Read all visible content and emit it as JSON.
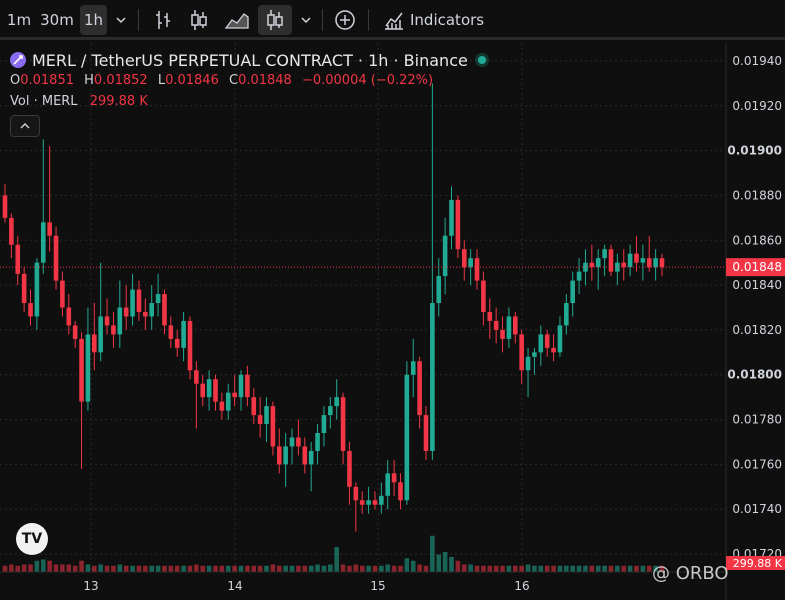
{
  "toolbar": {
    "intervals": [
      "1m",
      "30m",
      "1h"
    ],
    "active_interval": "1h",
    "indicators_label": "Indicators",
    "icons": [
      "chevron-down-icon",
      "bar-style-icon",
      "candle-style-icon",
      "area-style-icon",
      "hollow-candle-style-icon",
      "chevron-down-icon",
      "add-compare-icon",
      "indicators-icon"
    ]
  },
  "legend": {
    "title": "MERL / TetherUS PERPETUAL CONTRACT · 1h · Binance",
    "o_label": "O",
    "o_value": "0.01851",
    "h_label": "H",
    "h_value": "0.01852",
    "l_label": "L",
    "l_value": "0.01846",
    "c_label": "C",
    "c_value": "0.01848",
    "change": "−0.00004 (−0.22%)",
    "vol_label": "Vol · MERL",
    "vol_value": "299.88 K",
    "collapse_icon": "chevron-up-icon"
  },
  "branding": {
    "tv_logo": "TV",
    "watermark": "@ ORBO"
  },
  "colors": {
    "up": "#22ab94",
    "down": "#f23645",
    "grid": "#2a2a2a",
    "background": "#0f0f0f"
  },
  "chart_data": {
    "type": "candlestick",
    "symbol": "MERL / TetherUS PERPETUAL CONTRACT",
    "timeframe": "1h",
    "exchange": "Binance",
    "x_ticks": [
      "13",
      "14",
      "15",
      "16"
    ],
    "y_ticks": [
      "0.01720",
      "0.01740",
      "0.01760",
      "0.01780",
      "0.01800",
      "0.01820",
      "0.01840",
      "0.01860",
      "0.01880",
      "0.01900",
      "0.01920",
      "0.01940"
    ],
    "ylim": [
      0.01712,
      0.01948
    ],
    "grid": true,
    "last_price": "0.01848",
    "last_volume": "299.88 K",
    "candles": [
      [
        0.0188,
        0.01885,
        0.01868,
        0.0187
      ],
      [
        0.0187,
        0.01872,
        0.01852,
        0.01858
      ],
      [
        0.01858,
        0.01862,
        0.0184,
        0.01845
      ],
      [
        0.01845,
        0.01848,
        0.01828,
        0.01832
      ],
      [
        0.01832,
        0.01838,
        0.01822,
        0.01826
      ],
      [
        0.01826,
        0.01852,
        0.0182,
        0.0185
      ],
      [
        0.0185,
        0.01905,
        0.01845,
        0.01868
      ],
      [
        0.01868,
        0.01902,
        0.01855,
        0.01862
      ],
      [
        0.01862,
        0.01866,
        0.01838,
        0.01842
      ],
      [
        0.01842,
        0.01846,
        0.01826,
        0.0183
      ],
      [
        0.0183,
        0.01836,
        0.01818,
        0.01822
      ],
      [
        0.01822,
        0.01824,
        0.01812,
        0.01816
      ],
      [
        0.01816,
        0.01819,
        0.01758,
        0.01788
      ],
      [
        0.01788,
        0.0183,
        0.01784,
        0.01818
      ],
      [
        0.01818,
        0.01832,
        0.01802,
        0.0181
      ],
      [
        0.0181,
        0.0185,
        0.01806,
        0.01826
      ],
      [
        0.01826,
        0.01834,
        0.01818,
        0.01822
      ],
      [
        0.01822,
        0.01828,
        0.01812,
        0.01818
      ],
      [
        0.01818,
        0.01842,
        0.01812,
        0.0183
      ],
      [
        0.0183,
        0.0184,
        0.0182,
        0.01826
      ],
      [
        0.01826,
        0.01845,
        0.01822,
        0.01838
      ],
      [
        0.01838,
        0.01842,
        0.01824,
        0.01828
      ],
      [
        0.01828,
        0.01834,
        0.0182,
        0.01826
      ],
      [
        0.01826,
        0.0184,
        0.0182,
        0.01832
      ],
      [
        0.01832,
        0.01845,
        0.01826,
        0.01836
      ],
      [
        0.01836,
        0.01838,
        0.01818,
        0.01822
      ],
      [
        0.01822,
        0.01826,
        0.01812,
        0.01816
      ],
      [
        0.01816,
        0.0182,
        0.01808,
        0.01812
      ],
      [
        0.01812,
        0.01828,
        0.01806,
        0.01824
      ],
      [
        0.01824,
        0.01826,
        0.01798,
        0.01802
      ],
      [
        0.01802,
        0.01806,
        0.01776,
        0.01796
      ],
      [
        0.01796,
        0.018,
        0.01786,
        0.0179
      ],
      [
        0.0179,
        0.01802,
        0.01784,
        0.01798
      ],
      [
        0.01798,
        0.018,
        0.01784,
        0.01788
      ],
      [
        0.01788,
        0.01792,
        0.0178,
        0.01784
      ],
      [
        0.01784,
        0.01796,
        0.0178,
        0.01792
      ],
      [
        0.01792,
        0.018,
        0.01786,
        0.0179
      ],
      [
        0.0179,
        0.01802,
        0.01784,
        0.018
      ],
      [
        0.018,
        0.01804,
        0.01786,
        0.0179
      ],
      [
        0.0179,
        0.01794,
        0.01778,
        0.01782
      ],
      [
        0.01782,
        0.0179,
        0.01772,
        0.01778
      ],
      [
        0.01778,
        0.0179,
        0.0177,
        0.01786
      ],
      [
        0.01786,
        0.01788,
        0.01764,
        0.01768
      ],
      [
        0.01768,
        0.01776,
        0.01756,
        0.0176
      ],
      [
        0.0176,
        0.01774,
        0.0175,
        0.01768
      ],
      [
        0.01768,
        0.01776,
        0.0176,
        0.01772
      ],
      [
        0.01772,
        0.0178,
        0.01764,
        0.01768
      ],
      [
        0.01768,
        0.01772,
        0.01756,
        0.0176
      ],
      [
        0.0176,
        0.0177,
        0.01748,
        0.01766
      ],
      [
        0.01766,
        0.01778,
        0.0176,
        0.01774
      ],
      [
        0.01774,
        0.01786,
        0.01768,
        0.01782
      ],
      [
        0.01782,
        0.0179,
        0.01776,
        0.01786
      ],
      [
        0.01786,
        0.01798,
        0.0178,
        0.0179
      ],
      [
        0.0179,
        0.01792,
        0.0176,
        0.01766
      ],
      [
        0.01766,
        0.0177,
        0.01742,
        0.0175
      ],
      [
        0.0175,
        0.01752,
        0.0173,
        0.01744
      ],
      [
        0.01744,
        0.01748,
        0.01738,
        0.01742
      ],
      [
        0.01742,
        0.0175,
        0.01738,
        0.01744
      ],
      [
        0.01744,
        0.01748,
        0.0174,
        0.01742
      ],
      [
        0.01742,
        0.01752,
        0.01738,
        0.01746
      ],
      [
        0.01746,
        0.01762,
        0.0174,
        0.01756
      ],
      [
        0.01756,
        0.01762,
        0.01746,
        0.01752
      ],
      [
        0.01752,
        0.01756,
        0.0174,
        0.01744
      ],
      [
        0.01744,
        0.01806,
        0.01742,
        0.018
      ],
      [
        0.018,
        0.01816,
        0.0179,
        0.01806
      ],
      [
        0.01806,
        0.01808,
        0.01776,
        0.01782
      ],
      [
        0.01782,
        0.01786,
        0.01762,
        0.01766
      ],
      [
        0.01766,
        0.0193,
        0.01762,
        0.01832
      ],
      [
        0.01832,
        0.01852,
        0.01826,
        0.01844
      ],
      [
        0.01844,
        0.0187,
        0.01836,
        0.01862
      ],
      [
        0.01862,
        0.01884,
        0.01856,
        0.01878
      ],
      [
        0.01878,
        0.0188,
        0.01852,
        0.01856
      ],
      [
        0.01856,
        0.0186,
        0.01842,
        0.01848
      ],
      [
        0.01848,
        0.01856,
        0.0184,
        0.01852
      ],
      [
        0.01852,
        0.01856,
        0.01838,
        0.01842
      ],
      [
        0.01842,
        0.01846,
        0.01822,
        0.01828
      ],
      [
        0.01828,
        0.01834,
        0.01816,
        0.01824
      ],
      [
        0.01824,
        0.0183,
        0.01814,
        0.0182
      ],
      [
        0.0182,
        0.01826,
        0.0181,
        0.01816
      ],
      [
        0.01816,
        0.0183,
        0.01812,
        0.01826
      ],
      [
        0.01826,
        0.01828,
        0.01814,
        0.01818
      ],
      [
        0.01818,
        0.0182,
        0.01796,
        0.01802
      ],
      [
        0.01802,
        0.01812,
        0.0179,
        0.01808
      ],
      [
        0.01808,
        0.01812,
        0.018,
        0.0181
      ],
      [
        0.0181,
        0.01822,
        0.01804,
        0.01818
      ],
      [
        0.01818,
        0.0182,
        0.01808,
        0.01812
      ],
      [
        0.01812,
        0.01818,
        0.01806,
        0.0181
      ],
      [
        0.0181,
        0.01826,
        0.01808,
        0.01822
      ],
      [
        0.01822,
        0.01836,
        0.01818,
        0.01832
      ],
      [
        0.01832,
        0.01846,
        0.01826,
        0.01842
      ],
      [
        0.01842,
        0.01852,
        0.01836,
        0.01846
      ],
      [
        0.01846,
        0.01856,
        0.0184,
        0.0185
      ],
      [
        0.0185,
        0.01858,
        0.01842,
        0.01848
      ],
      [
        0.01848,
        0.01856,
        0.01838,
        0.01852
      ],
      [
        0.01852,
        0.01858,
        0.01844,
        0.01856
      ],
      [
        0.01856,
        0.01858,
        0.01844,
        0.01846
      ],
      [
        0.01846,
        0.01854,
        0.0184,
        0.0185
      ],
      [
        0.0185,
        0.01856,
        0.01842,
        0.01848
      ],
      [
        0.01848,
        0.01858,
        0.01844,
        0.01854
      ],
      [
        0.01854,
        0.01862,
        0.01846,
        0.0185
      ],
      [
        0.0185,
        0.01858,
        0.01842,
        0.01852
      ],
      [
        0.01852,
        0.01862,
        0.01846,
        0.01848
      ],
      [
        0.01848,
        0.01856,
        0.01842,
        0.01852
      ],
      [
        0.01852,
        0.01854,
        0.01844,
        0.01848
      ]
    ],
    "volumes": [
      0.5,
      0.6,
      0.5,
      0.6,
      0.6,
      0.9,
      1.0,
      0.9,
      0.6,
      0.6,
      0.6,
      0.5,
      0.9,
      0.6,
      0.5,
      0.6,
      0.5,
      0.5,
      0.6,
      0.5,
      0.5,
      0.5,
      0.5,
      0.5,
      0.5,
      0.5,
      0.5,
      0.5,
      0.5,
      0.5,
      0.6,
      0.5,
      0.5,
      0.5,
      0.5,
      0.5,
      0.5,
      0.5,
      0.5,
      0.5,
      0.5,
      0.5,
      0.6,
      0.5,
      0.5,
      0.5,
      0.5,
      0.5,
      0.5,
      0.6,
      0.5,
      0.6,
      2.0,
      0.6,
      0.5,
      0.6,
      0.5,
      0.5,
      0.5,
      0.5,
      0.6,
      0.5,
      0.5,
      1.1,
      0.9,
      0.6,
      0.5,
      2.9,
      1.4,
      1.6,
      1.2,
      0.9,
      0.6,
      0.6,
      0.5,
      0.5,
      0.5,
      0.5,
      0.5,
      0.5,
      0.5,
      0.5,
      0.6,
      0.5,
      0.5,
      0.5,
      0.5,
      0.5,
      0.5,
      0.5,
      0.5,
      0.5,
      0.5,
      0.5,
      0.5,
      0.5,
      0.5,
      0.5,
      0.5,
      0.5,
      0.5,
      0.5,
      0.5,
      0.5,
      0.5
    ]
  }
}
